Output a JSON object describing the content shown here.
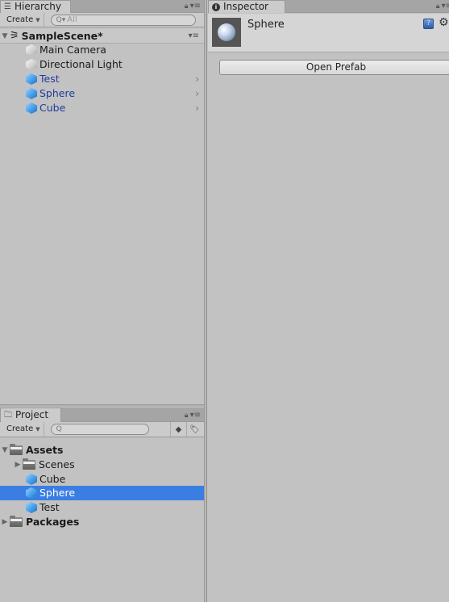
{
  "hierarchy": {
    "tab_label": "Hierarchy",
    "tab_icon": "list-icon",
    "create_label": "Create",
    "search_placeholder": "All",
    "scene": {
      "name": "SampleScene*",
      "expanded": true
    },
    "items": [
      {
        "label": "Main Camera",
        "icon": "gameobject-icon",
        "prefab": false
      },
      {
        "label": "Directional Light",
        "icon": "gameobject-icon",
        "prefab": false
      },
      {
        "label": "Test",
        "icon": "prefab-icon",
        "prefab": true
      },
      {
        "label": "Sphere",
        "icon": "prefab-icon",
        "prefab": true
      },
      {
        "label": "Cube",
        "icon": "prefab-icon",
        "prefab": true
      }
    ]
  },
  "inspector": {
    "tab_label": "Inspector",
    "tab_icon": "info-icon",
    "object_name": "Sphere",
    "open_prefab_label": "Open Prefab"
  },
  "project": {
    "tab_label": "Project",
    "tab_icon": "folder-icon",
    "create_label": "Create",
    "search_placeholder": "",
    "tree": [
      {
        "label": "Assets",
        "type": "folder",
        "depth": 0,
        "expanded": true,
        "bold": true
      },
      {
        "label": "Scenes",
        "type": "folder",
        "depth": 1,
        "expanded": false,
        "bold": false
      },
      {
        "label": "Cube",
        "type": "prefab",
        "depth": 1,
        "selected": false
      },
      {
        "label": "Sphere",
        "type": "prefab",
        "depth": 1,
        "selected": true
      },
      {
        "label": "Test",
        "type": "prefab",
        "depth": 1,
        "selected": false
      },
      {
        "label": "Packages",
        "type": "folder",
        "depth": 0,
        "expanded": false,
        "bold": true
      }
    ]
  },
  "colors": {
    "selection": "#3a7ee4",
    "prefab_text": "#1f3d9e",
    "panel_bg": "#c2c2c2"
  }
}
